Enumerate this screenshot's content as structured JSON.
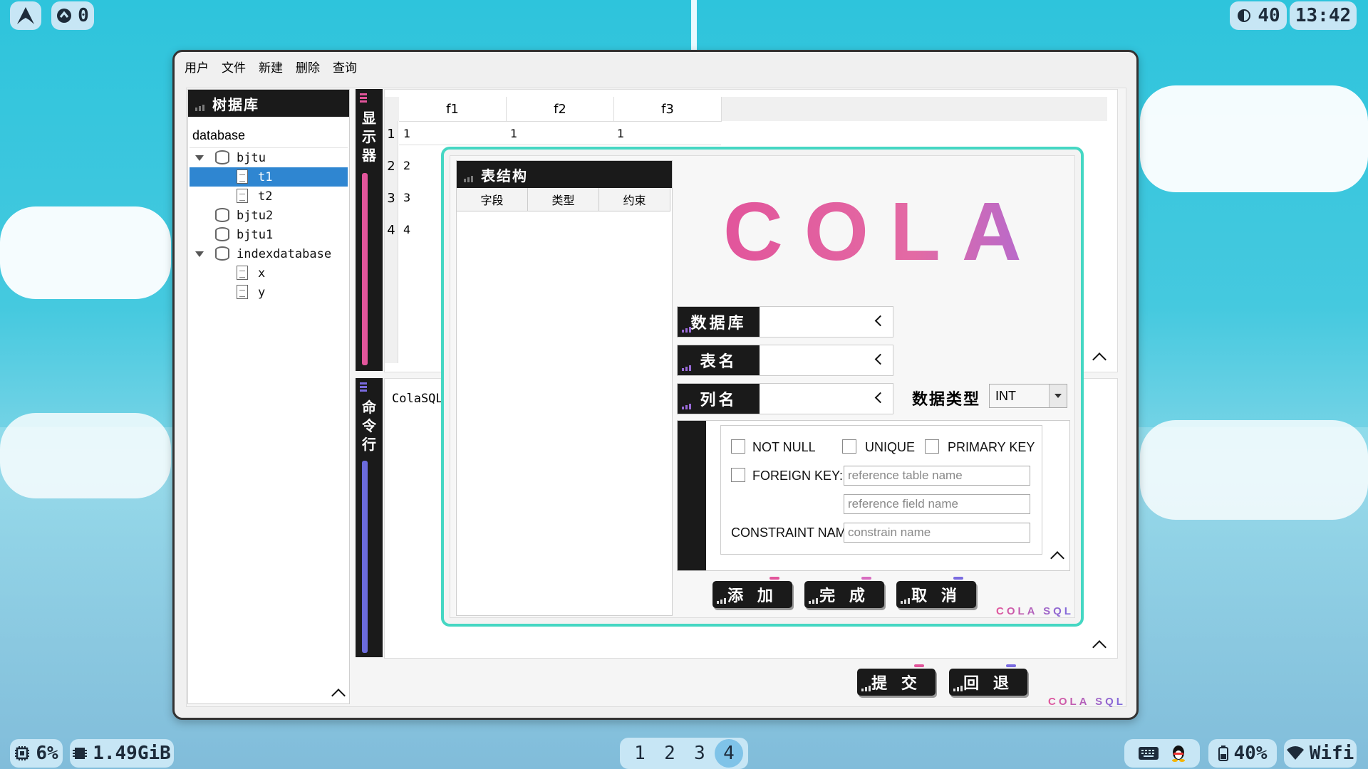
{
  "topbar": {
    "notif_count": "0",
    "brightness": "40",
    "clock": "13:42"
  },
  "bottombar": {
    "cpu": "6%",
    "memory": "1.49GiB",
    "workspaces": [
      "1",
      "2",
      "3",
      "4"
    ],
    "active_workspace": "4",
    "battery": "40%",
    "wifi": "Wifi"
  },
  "menu": [
    "用户",
    "文件",
    "新建",
    "删除",
    "查询"
  ],
  "tree_panel": {
    "title": "树据库",
    "header": "database",
    "items": [
      {
        "label": "bjtu",
        "kind": "db",
        "expanded": true
      },
      {
        "label": "t1",
        "kind": "table",
        "selected": true
      },
      {
        "label": "t2",
        "kind": "table"
      },
      {
        "label": "bjtu2",
        "kind": "db"
      },
      {
        "label": "bjtu1",
        "kind": "db"
      },
      {
        "label": "indexdatabase",
        "kind": "db",
        "expanded": true
      },
      {
        "label": "x",
        "kind": "table"
      },
      {
        "label": "y",
        "kind": "table"
      }
    ]
  },
  "display_panel": {
    "strip_label": "显示器",
    "columns": [
      "f1",
      "f2",
      "f3"
    ],
    "rows": [
      {
        "n": "1",
        "cells": [
          "1",
          "1",
          "1"
        ]
      },
      {
        "n": "2",
        "cells": [
          "2"
        ]
      },
      {
        "n": "3",
        "cells": [
          "3"
        ]
      },
      {
        "n": "4",
        "cells": [
          "4"
        ]
      }
    ]
  },
  "command_panel": {
    "strip_label": "命令行",
    "text": "ColaSQL"
  },
  "main_buttons": {
    "submit": "提 交",
    "rollback": "回 退"
  },
  "brand": "COLA SQL",
  "dialog": {
    "struct_title": "表结构",
    "struct_columns": [
      "字段",
      "类型",
      "约束"
    ],
    "logo": "COLA",
    "fields": {
      "database": "数据库",
      "table": "表名",
      "column": "列名"
    },
    "data_type_label": "数据类型",
    "data_type_value": "INT",
    "constraints": {
      "not_null": "NOT NULL",
      "unique": "UNIQUE",
      "primary_key": "PRIMARY KEY",
      "foreign_key": "FOREIGN KEY:",
      "ref_table_placeholder": "reference table name",
      "ref_field_placeholder": "reference field name",
      "constraint_name_label": "CONSTRAINT NAM",
      "constraint_name_placeholder": "constrain name"
    },
    "buttons": {
      "add": "添 加",
      "done": "完 成",
      "cancel": "取 消"
    },
    "brand": "COLA SQL"
  },
  "colors": {
    "pink": "#e2559b",
    "purple": "#9a6bd8",
    "teal": "#45d7c3",
    "dark": "#1a1a1a"
  }
}
